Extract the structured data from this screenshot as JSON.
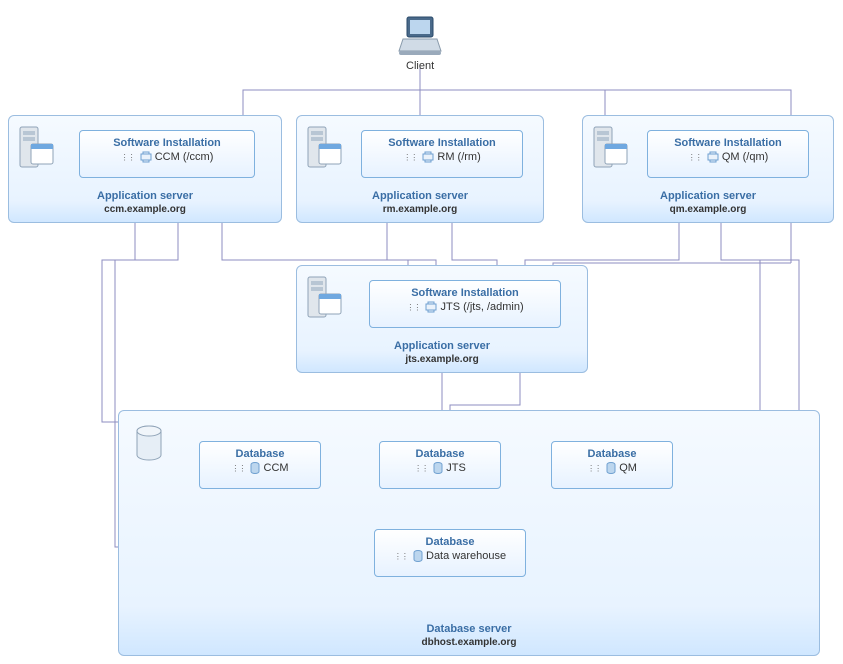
{
  "client": {
    "label": "Client"
  },
  "ccmServer": {
    "role": "Application server",
    "host": "ccm.example.org",
    "box": {
      "title": "Software Installation",
      "sub": "CCM (/ccm)"
    }
  },
  "rmServer": {
    "role": "Application server",
    "host": "rm.example.org",
    "box": {
      "title": "Software Installation",
      "sub": "RM (/rm)"
    }
  },
  "qmServer": {
    "role": "Application server",
    "host": "qm.example.org",
    "box": {
      "title": "Software Installation",
      "sub": "QM (/qm)"
    }
  },
  "jtsServer": {
    "role": "Application server",
    "host": "jts.example.org",
    "box": {
      "title": "Software Installation",
      "sub": "JTS (/jts, /admin)"
    }
  },
  "dbServer": {
    "role": "Database server",
    "host": "dbhost.example.org",
    "ccm": {
      "title": "Database",
      "sub": "CCM"
    },
    "jts": {
      "title": "Database",
      "sub": "JTS"
    },
    "qm": {
      "title": "Database",
      "sub": "QM"
    },
    "dw": {
      "title": "Database",
      "sub": "Data warehouse"
    }
  }
}
